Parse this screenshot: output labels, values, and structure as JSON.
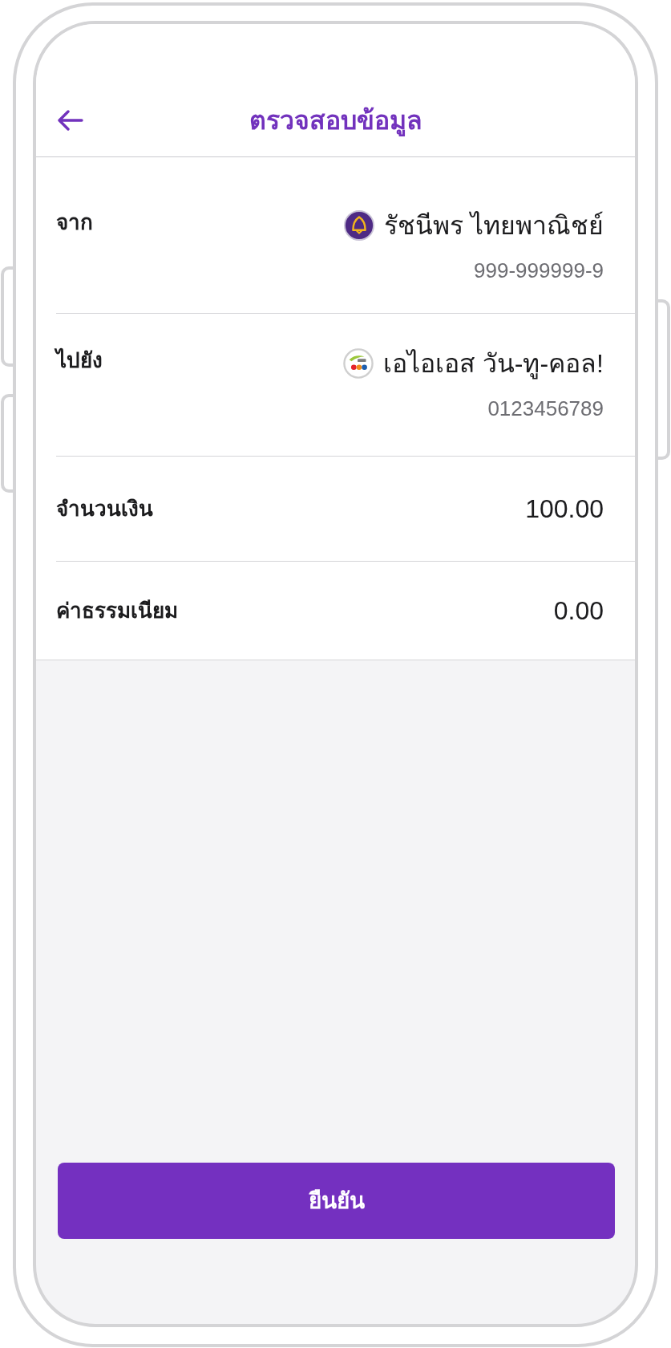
{
  "header": {
    "title": "ตรวจสอบข้อมูล"
  },
  "rows": [
    {
      "kind": "bank",
      "label": "จาก",
      "name": "รัชนีพร ไทยพาณิชย์",
      "detail": "999-999999-9"
    },
    {
      "kind": "mobile",
      "label": "ไปยัง",
      "name": "เอไอเอส วัน-ทู-คอล!",
      "detail": "0123456789"
    },
    {
      "kind": "amount",
      "label": "จำนวนเงิน",
      "value": "100.00"
    },
    {
      "kind": "amount",
      "label": "ค่าธรรมเนียม",
      "value": "0.00"
    }
  ],
  "confirm_button": {
    "label": "ยืนยัน"
  }
}
